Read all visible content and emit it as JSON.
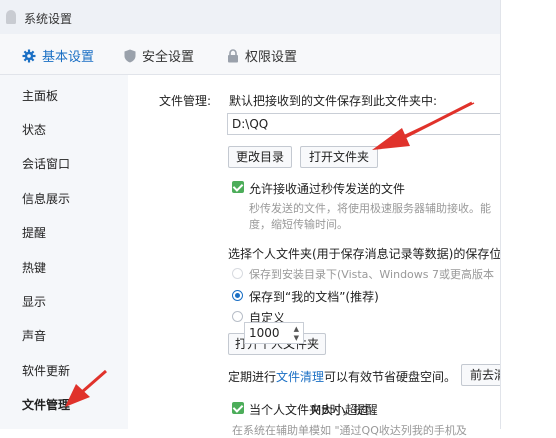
{
  "window": {
    "title": "系统设置"
  },
  "tabs": [
    {
      "label": "基本设置",
      "icon": "gear-icon",
      "active": true
    },
    {
      "label": "安全设置",
      "icon": "shield-icon",
      "active": false
    },
    {
      "label": "权限设置",
      "icon": "lock-icon",
      "active": false
    }
  ],
  "sidebar": {
    "items": [
      {
        "label": "主面板"
      },
      {
        "label": "状态"
      },
      {
        "label": "会话窗口"
      },
      {
        "label": "信息展示"
      },
      {
        "label": "提醒"
      },
      {
        "label": "热键"
      },
      {
        "label": "显示"
      },
      {
        "label": "声音"
      },
      {
        "label": "软件更新"
      },
      {
        "label": "文件管理",
        "active": true
      }
    ]
  },
  "file_mgmt": {
    "label": "文件管理:",
    "save_desc": "默认把接收到的文件保存到此文件夹中:",
    "path_value": "D:\\QQ",
    "change_dir_button": "更改目录",
    "open_folder_button": "打开文件夹",
    "allow_fast_send": {
      "checked": true,
      "label": "允许接收通过秒传发送的文件"
    },
    "fast_send_desc_1": "秒传发送的文件，将使用极速服务器辅助接收。能",
    "fast_send_desc_2": "度，缩短传输时间。",
    "personal_folder_prompt": "选择个人文件夹(用于保存消息记录等数据)的保存位置。",
    "radio_options": [
      {
        "label": "保存到安装目录下(Vista、Windows 7或更高版本",
        "selected": false,
        "disabled": true
      },
      {
        "label": "保存到“我的文档”(推荐)",
        "selected": true,
        "disabled": false
      },
      {
        "label": "自定义",
        "selected": false,
        "disabled": false
      }
    ],
    "open_personal_folder_button": "打开个人文件夹",
    "cleanup_prefix": "定期进行",
    "cleanup_link": "文件清理",
    "cleanup_suffix": "可以有效节省硬盘空间。",
    "cleanup_button": "前去清",
    "size_limit": {
      "checked": true,
      "label": "当个人文件夹大小超过",
      "value": "1000",
      "suffix": "MB时，提醒"
    },
    "last_line_partial": "在系统在辅助单模如 \"通过QQ收达列我的手机及",
    "colors": {
      "accent": "#1a6fc4",
      "check": "#4cad5a",
      "arrow": "#e0322b"
    }
  }
}
